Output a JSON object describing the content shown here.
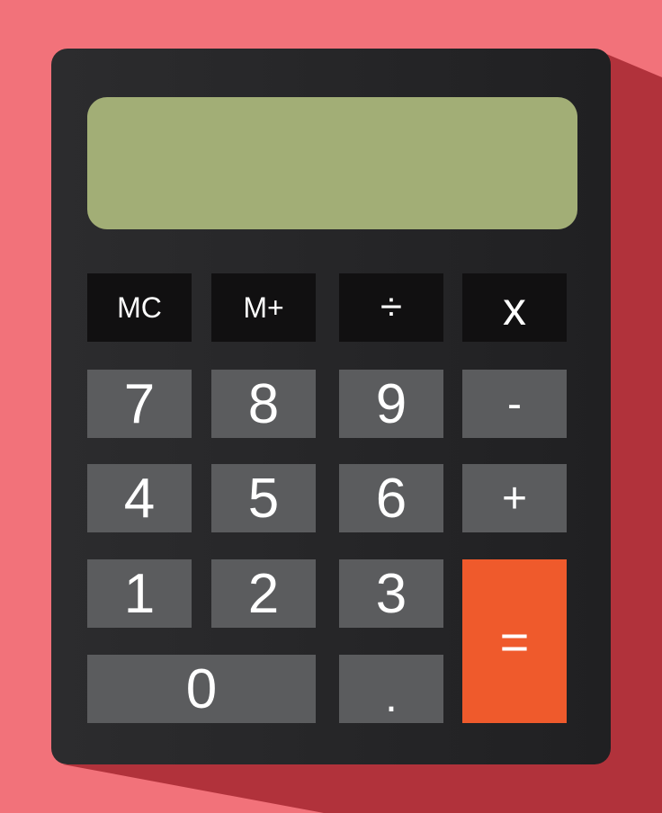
{
  "display": {
    "value": ""
  },
  "keys": {
    "memory_clear": "MC",
    "memory_add": "M+",
    "divide": "÷",
    "multiply": "x",
    "seven": "7",
    "eight": "8",
    "nine": "9",
    "subtract": "-",
    "four": "4",
    "five": "5",
    "six": "6",
    "add": "+",
    "one": "1",
    "two": "2",
    "three": "3",
    "equals": "=",
    "zero": "0",
    "decimal": "."
  },
  "colors": {
    "background": "#f2727a",
    "shadow": "#b1323b",
    "body": "#262628",
    "display": "#a2ae76",
    "top_keys": "#111011",
    "keys": "#5b5c5e",
    "equals_key": "#ef5a2c"
  }
}
